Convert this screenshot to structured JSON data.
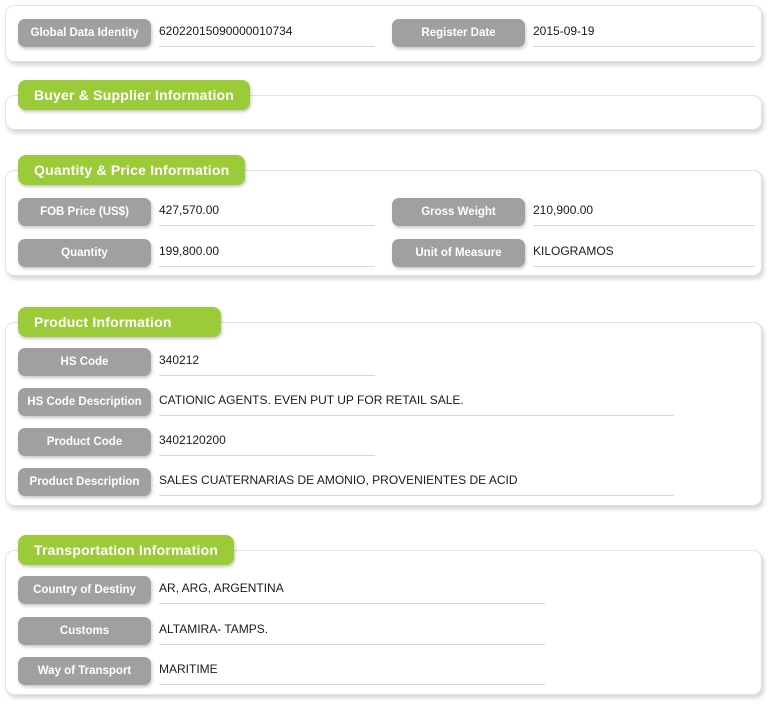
{
  "sections": [
    {
      "id": "identity",
      "title": null,
      "fields": [
        {
          "label": "Global Data Identity",
          "value": "62022015090000010734",
          "column": "left"
        },
        {
          "label": "Register Date",
          "value": "2015-09-19",
          "column": "right"
        }
      ]
    },
    {
      "id": "buyer_supplier",
      "title": "Buyer & Supplier Information",
      "fields": []
    },
    {
      "id": "quantity_price",
      "title": "Quantity & Price Information",
      "fields": [
        {
          "label": "FOB Price (US$)",
          "value": "427,570.00",
          "column": "left"
        },
        {
          "label": "Gross Weight",
          "value": "210,900.00",
          "column": "right"
        },
        {
          "label": "Quantity",
          "value": "199,800.00",
          "column": "left"
        },
        {
          "label": "Unit of Measure",
          "value": "KILOGRAMOS",
          "column": "right"
        }
      ]
    },
    {
      "id": "product",
      "title": "Product Information",
      "fields": [
        {
          "label": "HS Code",
          "value": "340212",
          "column": "left"
        },
        {
          "label": "HS Code Description",
          "value": "CATIONIC AGENTS. EVEN PUT UP FOR RETAIL SALE.",
          "column": "full"
        },
        {
          "label": "Product Code",
          "value": "3402120200",
          "column": "left"
        },
        {
          "label": "Product Description",
          "value": "SALES CUATERNARIAS DE AMONIO, PROVENIENTES DE ACID",
          "column": "full"
        }
      ]
    },
    {
      "id": "transportation",
      "title": "Transportation Information",
      "fields": [
        {
          "label": "Country of Destiny",
          "value": "AR, ARG, ARGENTINA",
          "column": "trans"
        },
        {
          "label": "Customs",
          "value": "ALTAMIRA- TAMPS.",
          "column": "trans"
        },
        {
          "label": "Way of Transport",
          "value": "MARITIME",
          "column": "trans"
        }
      ]
    }
  ],
  "colors": {
    "accent_green": "#9bcb38",
    "pill_gray": "#a0a0a0",
    "panel_border": "#e2e2e2",
    "underline": "#d7d7d7",
    "text": "#1a1a1a"
  }
}
